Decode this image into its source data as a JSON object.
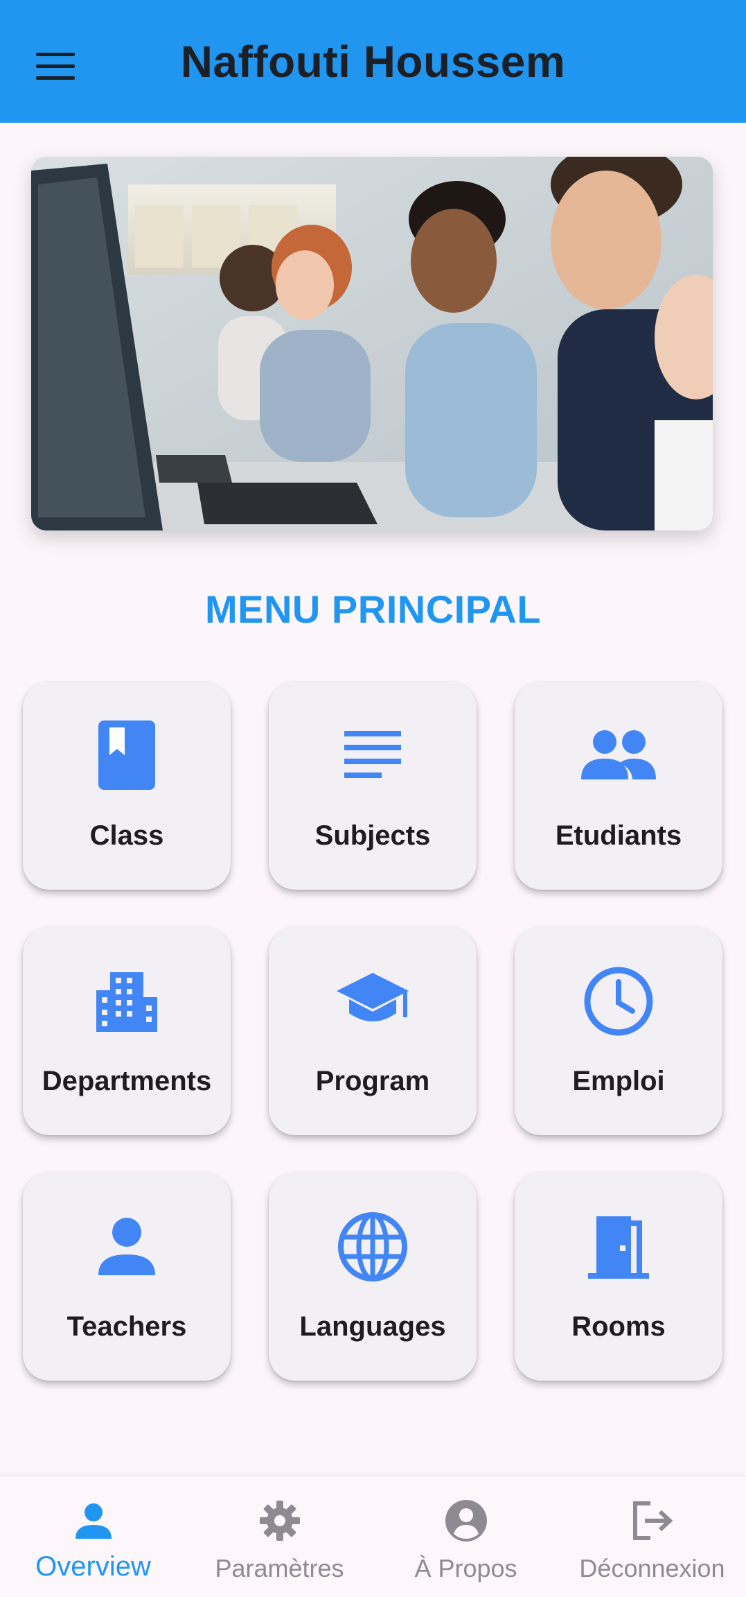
{
  "appbar": {
    "title": "Naffouti Houssem",
    "menu_icon": "hamburger-menu-icon",
    "background": "#2196f0"
  },
  "hero": {
    "description_icon": "classroom-photo"
  },
  "section": {
    "title": "MENU PRINCIPAL"
  },
  "menu": {
    "accent": "#4285f4",
    "tiles": [
      {
        "label": "Class",
        "icon": "book-bookmark-icon"
      },
      {
        "label": "Subjects",
        "icon": "text-lines-icon"
      },
      {
        "label": "Etudiants",
        "icon": "people-group-icon"
      },
      {
        "label": "Departments",
        "icon": "building-icon"
      },
      {
        "label": "Program",
        "icon": "graduation-cap-icon"
      },
      {
        "label": "Emploi",
        "icon": "clock-icon"
      },
      {
        "label": "Teachers",
        "icon": "person-icon"
      },
      {
        "label": "Languages",
        "icon": "globe-icon"
      },
      {
        "label": "Rooms",
        "icon": "door-icon"
      }
    ]
  },
  "bottom_nav": {
    "items": [
      {
        "label": "Overview",
        "icon": "person-icon",
        "active": true
      },
      {
        "label": "Paramètres",
        "icon": "gear-icon",
        "active": false
      },
      {
        "label": "À Propos",
        "icon": "account-circle-icon",
        "active": false
      },
      {
        "label": "Déconnexion",
        "icon": "logout-icon",
        "active": false
      }
    ],
    "active_color": "#2196f0",
    "inactive_color": "#8e8a92"
  }
}
